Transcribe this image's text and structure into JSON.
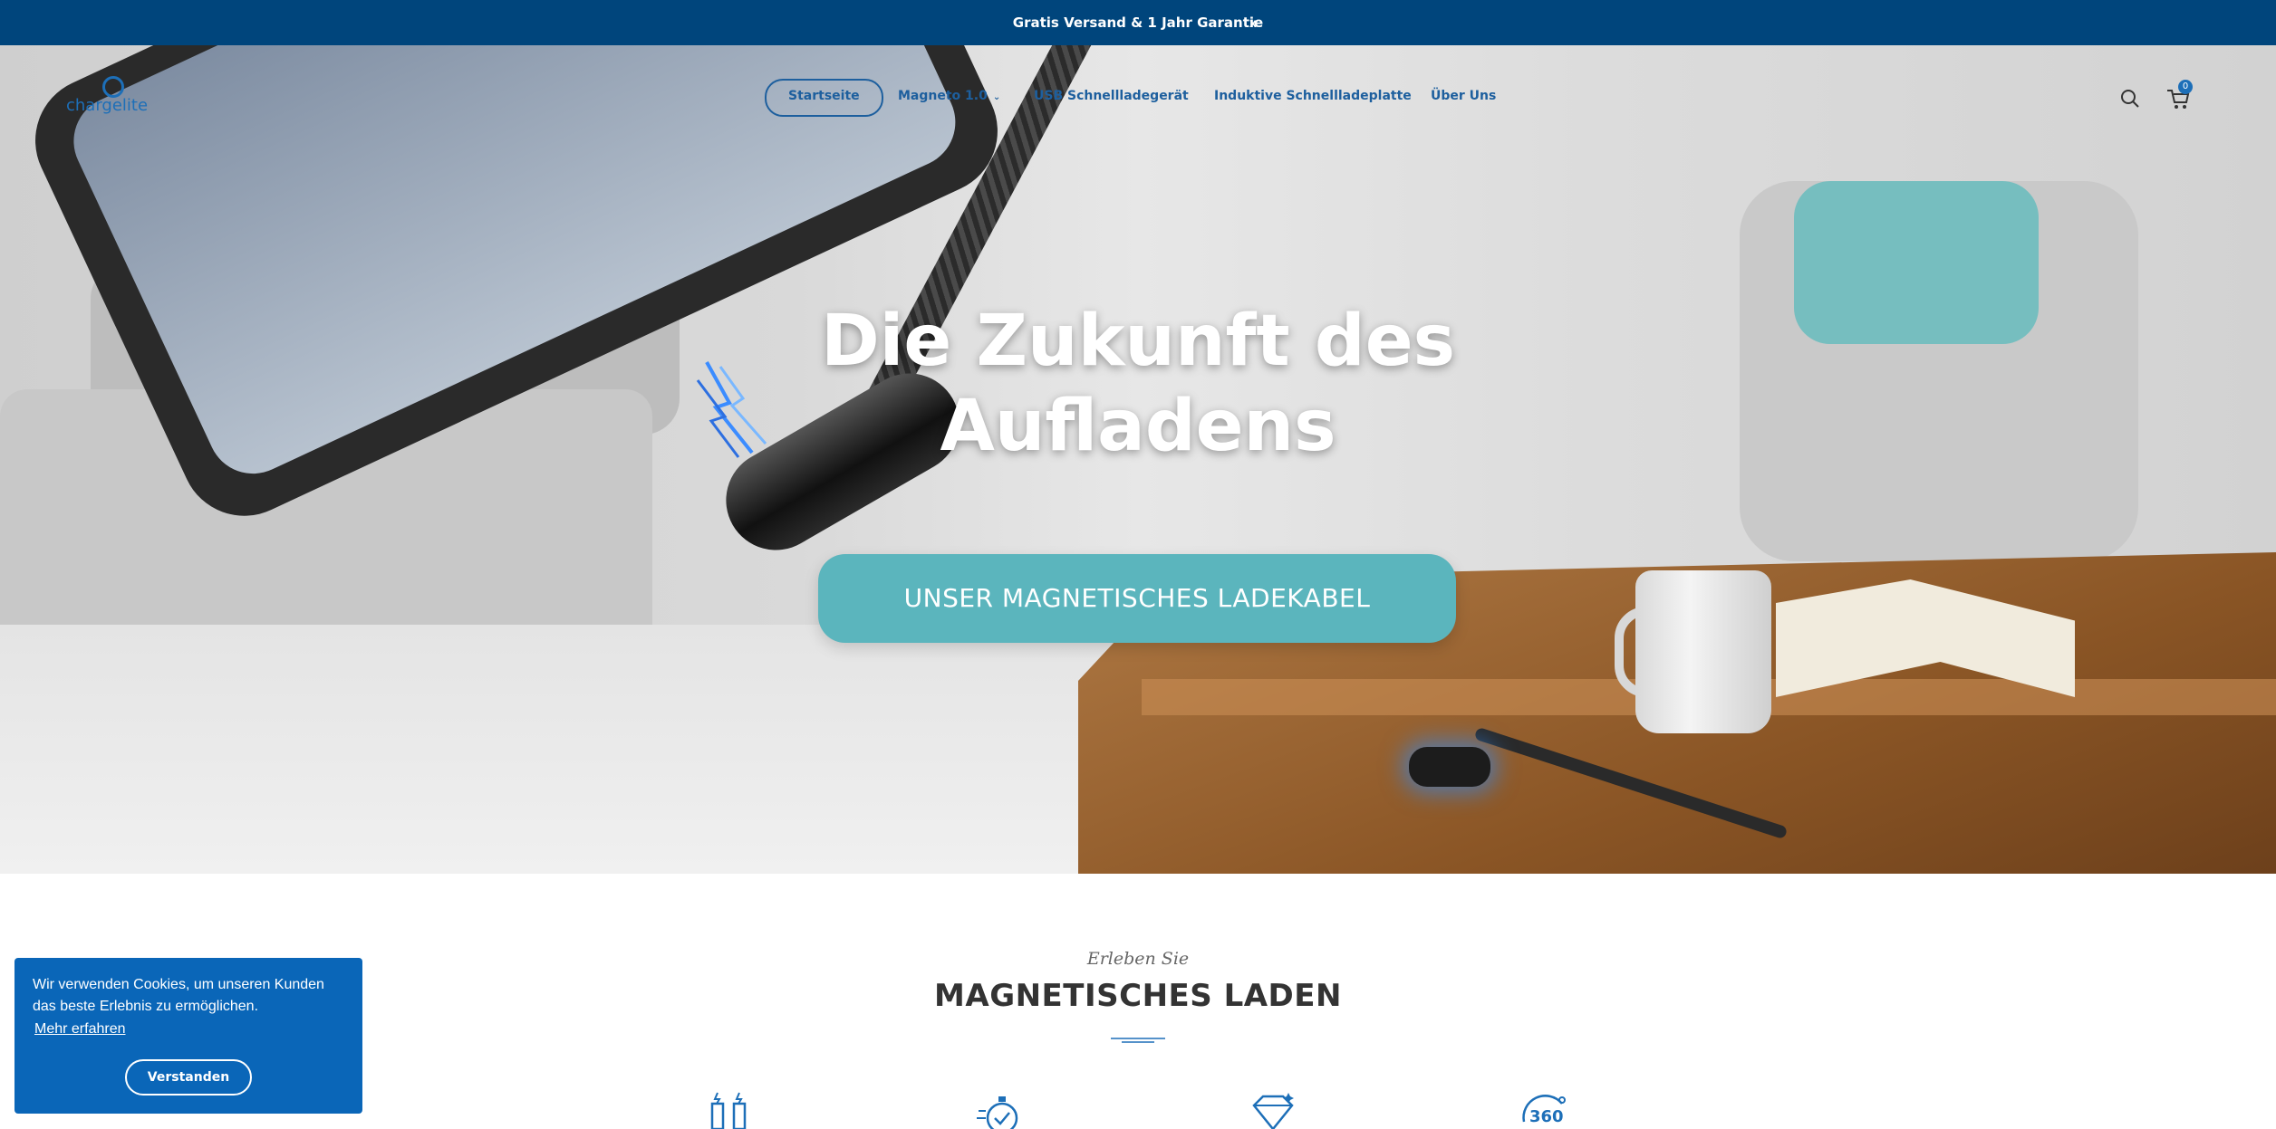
{
  "announcement": {
    "text": "Gratis Versand & 1 Jahr Garantie",
    "close_label": "x"
  },
  "header": {
    "logo_text": "chargelite",
    "nav": [
      {
        "label": "Startseite",
        "active": true
      },
      {
        "label": "Magneto 1.0",
        "has_dropdown": true
      },
      {
        "label": "USB Schnellladegerät"
      },
      {
        "label": "Induktive Schnellladeplatte"
      },
      {
        "label": "Über Uns"
      }
    ],
    "cart_count": "0",
    "icons": [
      "search-icon",
      "cart-icon"
    ]
  },
  "hero": {
    "title_line1": "Die Zukunft des",
    "title_line2": "Aufladens",
    "cta_label": "UNSER MAGNETISCHES LADEKABEL"
  },
  "section": {
    "kicker": "Erleben Sie",
    "title": "MAGNETISCHES LADEN"
  },
  "features": {
    "icons": [
      "charging-cables-icon",
      "stopwatch-icon",
      "diamond-icon",
      "360-rotation-icon"
    ]
  },
  "cookie": {
    "text": "Wir verwenden Cookies, um unseren Kunden das beste Erlebnis zu ermöglichen.",
    "link_label": "Mehr erfahren",
    "button_label": "Verstanden"
  },
  "colors": {
    "announcement_bg": "#00457c",
    "brand_blue": "#1d6fb8",
    "cta_bg": "#5bb5bd",
    "cookie_bg": "#0a66b8"
  }
}
